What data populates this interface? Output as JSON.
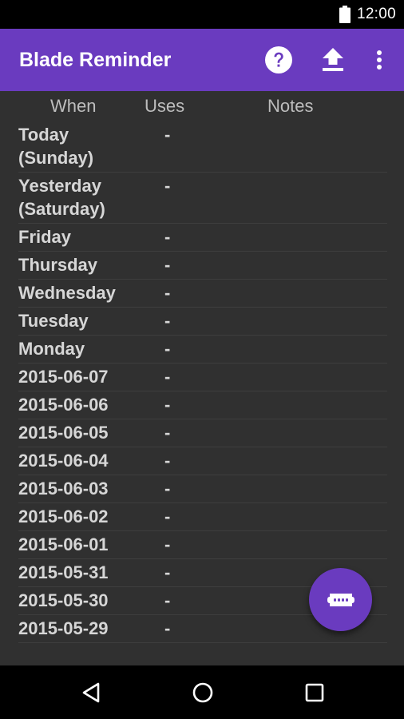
{
  "status_bar": {
    "time": "12:00",
    "icons": [
      "battery-icon"
    ]
  },
  "app_bar": {
    "title": "Blade Reminder",
    "actions": [
      "help-icon",
      "upload-icon",
      "more-vert-icon"
    ]
  },
  "table": {
    "headers": {
      "when": "When",
      "uses": "Uses",
      "notes": "Notes"
    },
    "rows": [
      {
        "when": "Today\n(Sunday)",
        "uses": "-",
        "notes": ""
      },
      {
        "when": "Yesterday\n(Saturday)",
        "uses": "-",
        "notes": ""
      },
      {
        "when": "Friday",
        "uses": "-",
        "notes": ""
      },
      {
        "when": "Thursday",
        "uses": "-",
        "notes": ""
      },
      {
        "when": "Wednesday",
        "uses": "-",
        "notes": ""
      },
      {
        "when": "Tuesday",
        "uses": "-",
        "notes": ""
      },
      {
        "when": "Monday",
        "uses": "-",
        "notes": ""
      },
      {
        "when": "2015-06-07",
        "uses": "-",
        "notes": ""
      },
      {
        "when": "2015-06-06",
        "uses": "-",
        "notes": ""
      },
      {
        "when": "2015-06-05",
        "uses": "-",
        "notes": ""
      },
      {
        "when": "2015-06-04",
        "uses": "-",
        "notes": ""
      },
      {
        "when": "2015-06-03",
        "uses": "-",
        "notes": ""
      },
      {
        "when": "2015-06-02",
        "uses": "-",
        "notes": ""
      },
      {
        "when": "2015-06-01",
        "uses": "-",
        "notes": ""
      },
      {
        "when": "2015-05-31",
        "uses": "-",
        "notes": ""
      },
      {
        "when": "2015-05-30",
        "uses": "-",
        "notes": ""
      },
      {
        "when": "2015-05-29",
        "uses": "-",
        "notes": ""
      }
    ]
  },
  "fab": {
    "icon": "razor-blade-icon"
  },
  "nav_bar": {
    "icons": [
      "back-icon",
      "home-icon",
      "recents-icon"
    ]
  },
  "colors": {
    "primary": "#6a3bbf",
    "background": "#303030",
    "text": "#d6d6d6",
    "header_text": "#bdbdbd"
  }
}
